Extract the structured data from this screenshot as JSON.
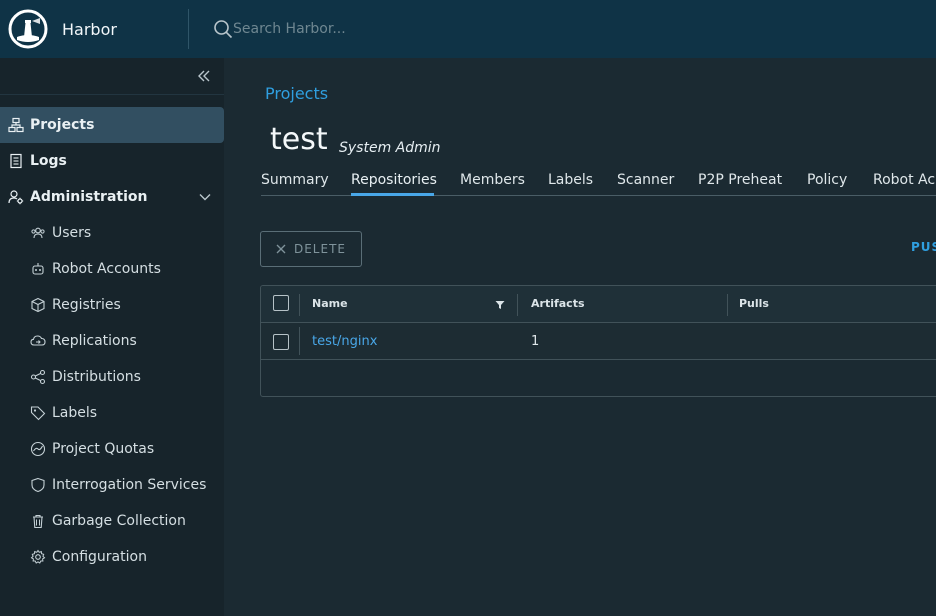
{
  "header": {
    "app_title": "Harbor",
    "search_placeholder": "Search Harbor..."
  },
  "sidebar": {
    "items": [
      {
        "label": "Projects",
        "icon": "projects-icon",
        "active": true
      },
      {
        "label": "Logs",
        "icon": "logs-icon"
      },
      {
        "label": "Administration",
        "icon": "administration-icon",
        "expanded": true
      }
    ],
    "admin_items": [
      {
        "label": "Users",
        "icon": "users-icon"
      },
      {
        "label": "Robot Accounts",
        "icon": "robot-icon"
      },
      {
        "label": "Registries",
        "icon": "registries-icon"
      },
      {
        "label": "Replications",
        "icon": "replications-icon"
      },
      {
        "label": "Distributions",
        "icon": "distributions-icon"
      },
      {
        "label": "Labels",
        "icon": "labels-icon"
      },
      {
        "label": "Project Quotas",
        "icon": "quotas-icon"
      },
      {
        "label": "Interrogation Services",
        "icon": "shield-icon"
      },
      {
        "label": "Garbage Collection",
        "icon": "trash-icon"
      },
      {
        "label": "Configuration",
        "icon": "gear-icon"
      }
    ]
  },
  "main": {
    "breadcrumb": "Projects",
    "project_name": "test",
    "role": "System Admin",
    "tabs": [
      {
        "label": "Summary"
      },
      {
        "label": "Repositories",
        "active": true
      },
      {
        "label": "Members"
      },
      {
        "label": "Labels"
      },
      {
        "label": "Scanner"
      },
      {
        "label": "P2P Preheat"
      },
      {
        "label": "Policy"
      },
      {
        "label": "Robot Ac"
      }
    ],
    "delete_label": "DELETE",
    "push_label": "PUS",
    "grid": {
      "columns": [
        "Name",
        "Artifacts",
        "Pulls"
      ],
      "rows": [
        {
          "name": "test/nginx",
          "artifacts": "1",
          "pulls": ""
        }
      ]
    }
  },
  "colors": {
    "header_bg": "#0f3346",
    "sidebar_bg": "#17242b",
    "main_bg": "#1b2a32",
    "accent": "#49a7e8",
    "active_nav": "#324f61"
  }
}
